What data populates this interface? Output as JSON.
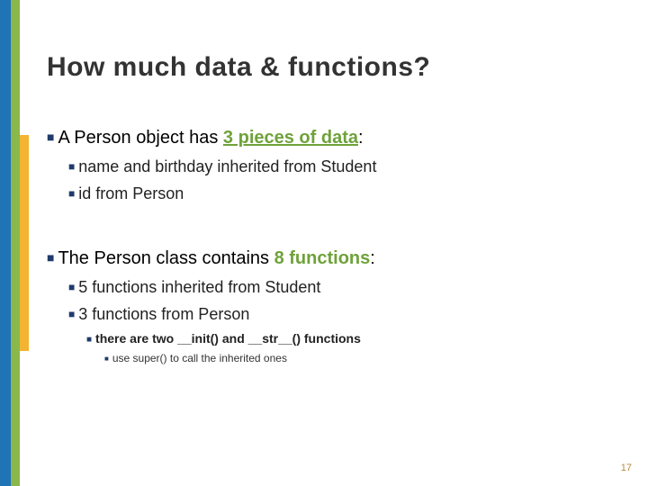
{
  "title": "How much data & functions?",
  "b1": {
    "pre": "A Person object has ",
    "hi": "3 pieces of data",
    "post": ":",
    "subs": [
      "name and birthday inherited from Student",
      "id from Person"
    ]
  },
  "b2": {
    "pre": "The Person class contains ",
    "hi": "8 functions",
    "post": ":",
    "subs": [
      "5 functions inherited from Student",
      "3 functions from Person"
    ],
    "lvl3": "there are two __init() and __str__() functions",
    "lvl4": "use super() to call the inherited ones"
  },
  "page": "17"
}
